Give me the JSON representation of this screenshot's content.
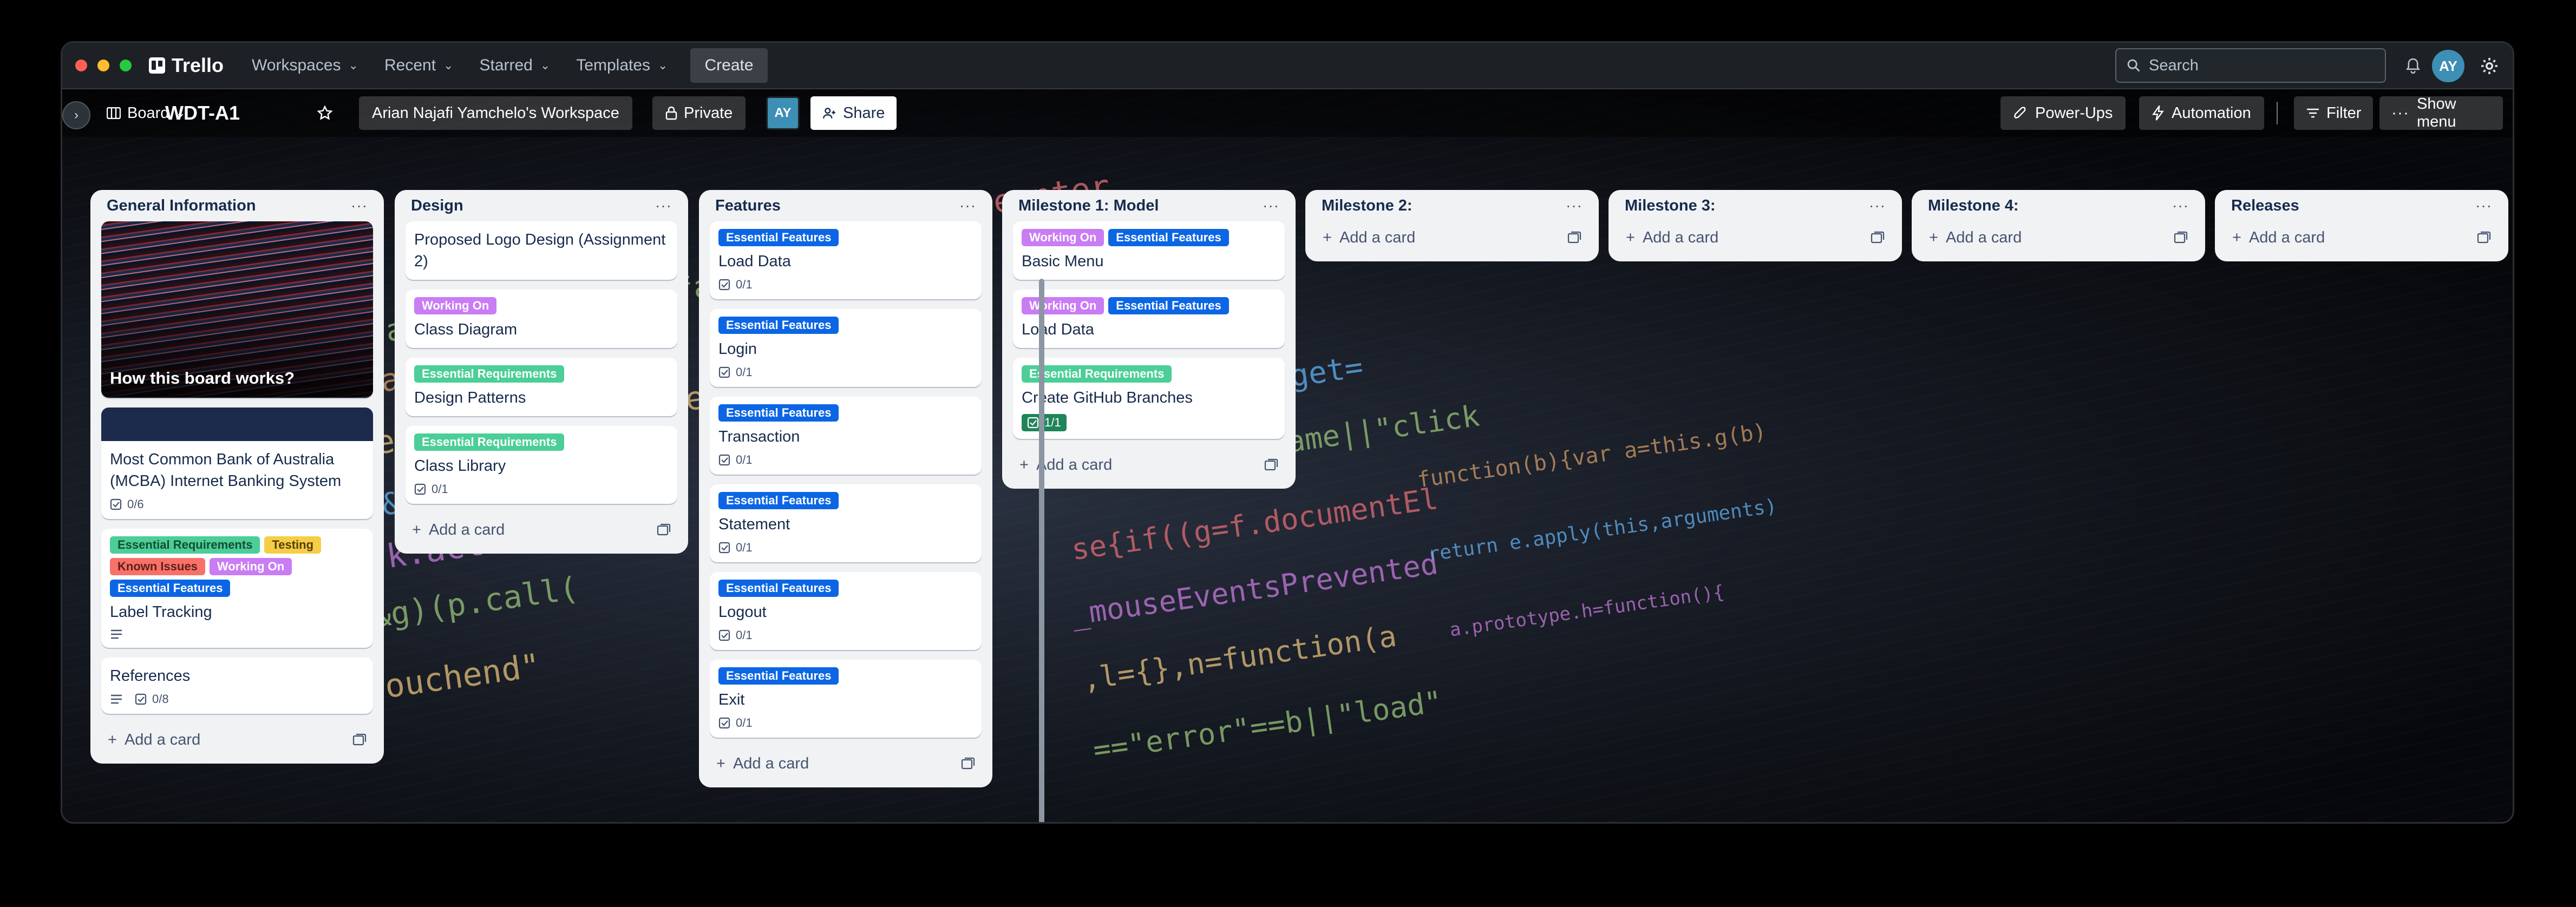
{
  "window": {
    "traffic_lights": [
      "#ff5f57",
      "#febc2e",
      "#28c840"
    ]
  },
  "topbar": {
    "app_name": "Trello",
    "menu": [
      "Workspaces",
      "Recent",
      "Starred",
      "Templates"
    ],
    "create_label": "Create",
    "search_placeholder": "Search",
    "avatar_initials": "AY"
  },
  "boardbar": {
    "view": "Board",
    "title": "WDT-A1",
    "workspace": "Arian Najafi Yamchelo's Workspace",
    "visibility": "Private",
    "member_initials": "AY",
    "share": "Share",
    "power_ups": "Power-Ups",
    "automation": "Automation",
    "filter": "Filter",
    "show_menu": "Show menu"
  },
  "colors": {
    "essential_features": "#0c66e4",
    "essential_requirements": "#4bce97",
    "working_on": "#c97cf4",
    "testing": "#f5cd47",
    "known_issues": "#f87168"
  },
  "lists": [
    {
      "title": "General Information",
      "add_card": "Add a card",
      "cards": [
        {
          "cover": true,
          "title": "How this board works?"
        },
        {
          "navy_cover": true,
          "title": "Most Common Bank of Australia (MCBA) Internet Banking System",
          "checklist": "0/6"
        },
        {
          "labels": [
            [
              "Essential Requirements",
              "#4bce97"
            ],
            [
              "Testing",
              "#f5cd47"
            ],
            [
              "Known Issues",
              "#f87168"
            ],
            [
              "Working On",
              "#c97cf4"
            ],
            [
              "Essential Features",
              "#0c66e4"
            ]
          ],
          "title": "Label Tracking",
          "description": true
        },
        {
          "title": "References",
          "description": true,
          "checklist": "0/8"
        }
      ]
    },
    {
      "title": "Design",
      "add_card": "Add a card",
      "cards": [
        {
          "title": "Proposed Logo Design (Assignment 2)"
        },
        {
          "labels": [
            [
              "Working On",
              "#c97cf4"
            ]
          ],
          "title": "Class Diagram"
        },
        {
          "labels": [
            [
              "Essential Requirements",
              "#4bce97"
            ]
          ],
          "title": "Design Patterns"
        },
        {
          "labels": [
            [
              "Essential Requirements",
              "#4bce97"
            ]
          ],
          "title": "Class Library",
          "checklist": "0/1"
        }
      ]
    },
    {
      "title": "Features",
      "add_card": "Add a card",
      "cards": [
        {
          "labels": [
            [
              "Essential Features",
              "#0c66e4"
            ]
          ],
          "title": "Load Data",
          "checklist": "0/1"
        },
        {
          "labels": [
            [
              "Essential Features",
              "#0c66e4"
            ]
          ],
          "title": "Login",
          "checklist": "0/1"
        },
        {
          "labels": [
            [
              "Essential Features",
              "#0c66e4"
            ]
          ],
          "title": "Transaction",
          "checklist": "0/1"
        },
        {
          "labels": [
            [
              "Essential Features",
              "#0c66e4"
            ]
          ],
          "title": "Statement",
          "checklist": "0/1"
        },
        {
          "labels": [
            [
              "Essential Features",
              "#0c66e4"
            ]
          ],
          "title": "Logout",
          "checklist": "0/1"
        },
        {
          "labels": [
            [
              "Essential Features",
              "#0c66e4"
            ]
          ],
          "title": "Exit",
          "checklist": "0/1"
        }
      ]
    },
    {
      "title": "Milestone 1: Model",
      "add_card": "Add a card",
      "cards": [
        {
          "labels": [
            [
              "Working On",
              "#c97cf4"
            ],
            [
              "Essential Features",
              "#0c66e4"
            ]
          ],
          "title": "Basic Menu"
        },
        {
          "labels": [
            [
              "Working On",
              "#c97cf4"
            ],
            [
              "Essential Features",
              "#0c66e4"
            ]
          ],
          "title": "Load Data"
        },
        {
          "labels": [
            [
              "Essential Requirements",
              "#4bce97"
            ]
          ],
          "title": "Create GitHub Branches",
          "checklist_done": "1/1"
        }
      ]
    },
    {
      "title": "Milestone 2:",
      "add_card": "Add a card",
      "cards": []
    },
    {
      "title": "Milestone 3:",
      "add_card": "Add a card",
      "cards": []
    },
    {
      "title": "Milestone 4:",
      "add_card": "Add a card",
      "cards": []
    },
    {
      "title": "Releases",
      "add_card": "Add a card",
      "cards": []
    }
  ]
}
